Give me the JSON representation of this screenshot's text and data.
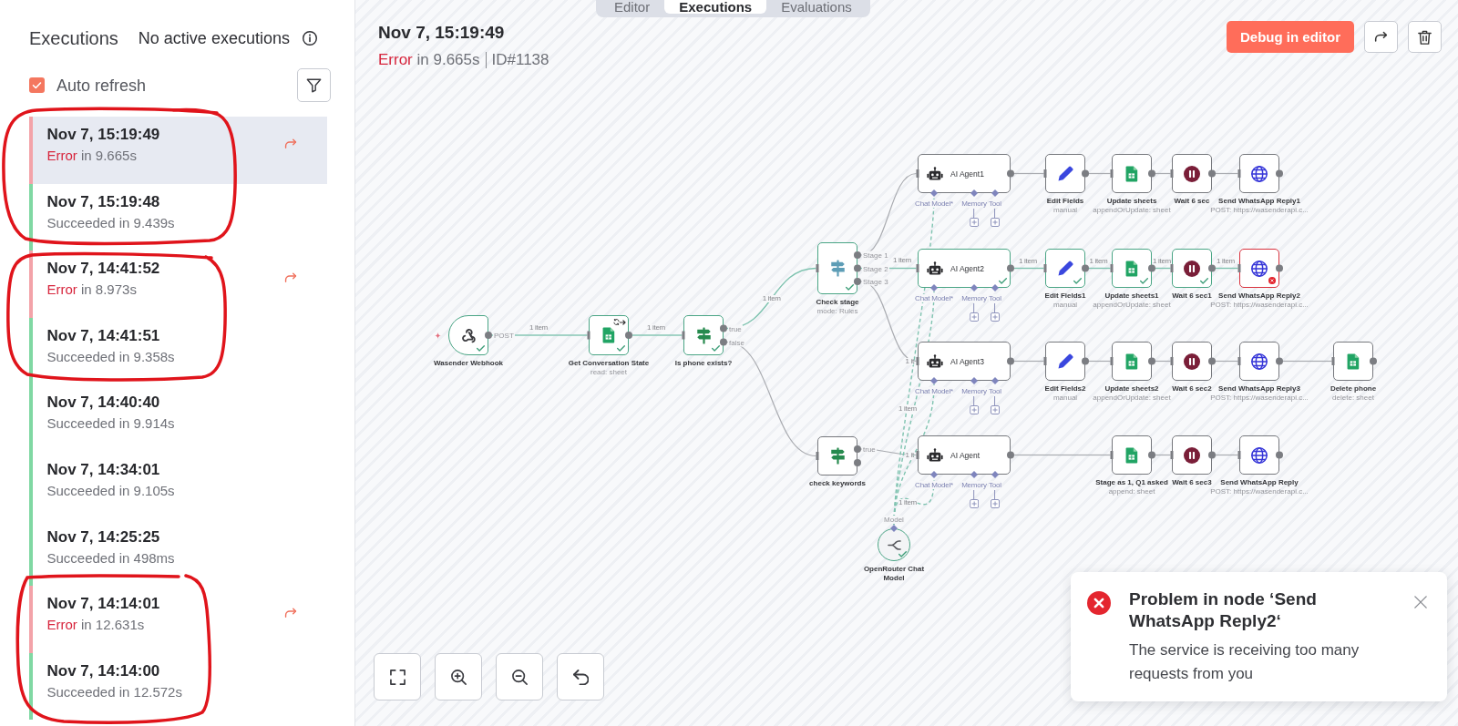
{
  "view_tabs": [
    {
      "label": "Editor",
      "selected": false
    },
    {
      "label": "Executions",
      "selected": true
    },
    {
      "label": "Evaluations",
      "selected": false
    }
  ],
  "sidebar": {
    "title": "Executions",
    "active_status": "No active executions",
    "auto_refresh": {
      "label": "Auto refresh",
      "checked": true
    },
    "executions": [
      {
        "time": "Nov 7, 15:19:49",
        "failed": true,
        "status_label": "Error",
        "duration": "in 9.665s",
        "selected": true
      },
      {
        "time": "Nov 7, 15:19:48",
        "failed": false,
        "status_label": "Succeeded",
        "duration": "in 9.439s",
        "selected": false
      },
      {
        "time": "Nov 7, 14:41:52",
        "failed": true,
        "status_label": "Error",
        "duration": "in 8.973s",
        "selected": false
      },
      {
        "time": "Nov 7, 14:41:51",
        "failed": false,
        "status_label": "Succeeded",
        "duration": "in 9.358s",
        "selected": false
      },
      {
        "time": "Nov 7, 14:40:40",
        "failed": false,
        "status_label": "Succeeded",
        "duration": "in 9.914s",
        "selected": false
      },
      {
        "time": "Nov 7, 14:34:01",
        "failed": false,
        "status_label": "Succeeded",
        "duration": "in 9.105s",
        "selected": false
      },
      {
        "time": "Nov 7, 14:25:25",
        "failed": false,
        "status_label": "Succeeded",
        "duration": "in 498ms",
        "selected": false
      },
      {
        "time": "Nov 7, 14:14:01",
        "failed": true,
        "status_label": "Error",
        "duration": "in 12.631s",
        "selected": false
      },
      {
        "time": "Nov 7, 14:14:00",
        "failed": false,
        "status_label": "Succeeded",
        "duration": "in 12.572s",
        "selected": false
      }
    ]
  },
  "execution_header": {
    "title": "Nov 7, 15:19:49",
    "failed": true,
    "status_label": "Error",
    "duration": "in 9.665s",
    "id": "ID#1138",
    "debug_button": "Debug in editor"
  },
  "workflow": {
    "nodes": [
      {
        "name": "Wasender Webhook",
        "kind": "webhook",
        "executed": true,
        "failed": false,
        "outputs": [
          "POST"
        ]
      },
      {
        "name": "Get Conversation State",
        "subtitle": "read: sheet",
        "kind": "sheets",
        "executed": true,
        "failed": false,
        "retry_on_fail": true,
        "always_output_data": true
      },
      {
        "name": "Is phone exists?",
        "kind": "if",
        "executed": true,
        "failed": false,
        "outputs": [
          "true",
          "false"
        ]
      },
      {
        "name": "Check stage",
        "subtitle": "mode: Rules",
        "kind": "switch",
        "executed": true,
        "failed": false,
        "outputs": [
          "Stage 1",
          "Stage 2",
          "Stage 3"
        ]
      },
      {
        "name": "check keywords",
        "kind": "if",
        "executed": false,
        "failed": false,
        "outputs": [
          "true"
        ]
      },
      {
        "name": "OpenRouter Chat Model",
        "kind": "chat_model",
        "executed": true,
        "failed": false,
        "outputs": [
          "Model"
        ]
      },
      {
        "name": "AI Agent1",
        "kind": "agent",
        "executed": false,
        "failed": false,
        "slots": [
          {
            "label": "Chat Model*",
            "add_button": false
          },
          {
            "label": "Memory",
            "add_button": true
          },
          {
            "label": "Tool",
            "add_button": true
          }
        ]
      },
      {
        "name": "Edit Fields",
        "subtitle": "manual",
        "kind": "set",
        "executed": false,
        "failed": false
      },
      {
        "name": "Update sheets",
        "subtitle": "appendOrUpdate: sheet",
        "kind": "sheets",
        "executed": false,
        "failed": false
      },
      {
        "name": "Wait 6 sec",
        "kind": "wait",
        "executed": false,
        "failed": false
      },
      {
        "name": "Send WhatsApp Reply1",
        "subtitle": "POST: https://wasenderapi.c...",
        "kind": "http",
        "executed": false,
        "failed": false
      },
      {
        "name": "AI Agent2",
        "kind": "agent",
        "executed": true,
        "failed": false,
        "slots": [
          {
            "label": "Chat Model*",
            "add_button": false
          },
          {
            "label": "Memory",
            "add_button": true
          },
          {
            "label": "Tool",
            "add_button": true
          }
        ]
      },
      {
        "name": "Edit Fields1",
        "subtitle": "manual",
        "kind": "set",
        "executed": true,
        "failed": false
      },
      {
        "name": "Update sheets1",
        "subtitle": "appendOrUpdate: sheet",
        "kind": "sheets",
        "executed": true,
        "failed": false
      },
      {
        "name": "Wait 6 sec1",
        "kind": "wait",
        "executed": true,
        "failed": false
      },
      {
        "name": "Send WhatsApp Reply2",
        "subtitle": "POST: https://wasenderapi.c...",
        "kind": "http",
        "executed": true,
        "failed": true
      },
      {
        "name": "AI Agent3",
        "kind": "agent",
        "executed": false,
        "failed": false,
        "slots": [
          {
            "label": "Chat Model*",
            "add_button": false
          },
          {
            "label": "Memory",
            "add_button": true
          },
          {
            "label": "Tool",
            "add_button": true
          }
        ]
      },
      {
        "name": "Edit Fields2",
        "subtitle": "manual",
        "kind": "set",
        "executed": false,
        "failed": false
      },
      {
        "name": "Update sheets2",
        "subtitle": "appendOrUpdate: sheet",
        "kind": "sheets",
        "executed": false,
        "failed": false
      },
      {
        "name": "Wait 6 sec2",
        "kind": "wait",
        "executed": false,
        "failed": false
      },
      {
        "name": "Send WhatsApp Reply3",
        "subtitle": "POST: https://wasenderapi.c...",
        "kind": "http",
        "executed": false,
        "failed": false
      },
      {
        "name": "Delete phone",
        "subtitle": "delete: sheet",
        "kind": "sheets",
        "executed": false,
        "failed": false
      },
      {
        "name": "AI Agent",
        "kind": "agent",
        "executed": false,
        "failed": false,
        "slots": [
          {
            "label": "Chat Model*",
            "add_button": false
          },
          {
            "label": "Memory",
            "add_button": true
          },
          {
            "label": "Tool",
            "add_button": true
          }
        ]
      },
      {
        "name": "Stage as 1, Q1 asked",
        "subtitle": "append: sheet",
        "kind": "sheets",
        "executed": false,
        "failed": false
      },
      {
        "name": "Wait 6 sec3",
        "kind": "wait",
        "executed": false,
        "failed": false
      },
      {
        "name": "Send WhatsApp Reply",
        "subtitle": "POST: https://wasenderapi.c...",
        "kind": "http",
        "executed": false,
        "failed": false
      }
    ],
    "connections": [
      {
        "kind": "main",
        "executed": true,
        "label": "1 item"
      },
      {
        "kind": "main",
        "executed": true,
        "label": "1 item"
      },
      {
        "kind": "main",
        "executed": true,
        "label": "1 item"
      },
      {
        "kind": "main",
        "executed": false
      },
      {
        "kind": "main",
        "executed": false
      },
      {
        "kind": "main",
        "executed": true,
        "label": "1 item"
      },
      {
        "kind": "main",
        "executed": false
      },
      {
        "kind": "main",
        "executed": false
      },
      {
        "kind": "main",
        "executed": false
      },
      {
        "kind": "main",
        "executed": false
      },
      {
        "kind": "main",
        "executed": false
      },
      {
        "kind": "main",
        "executed": false
      },
      {
        "kind": "main",
        "executed": true,
        "label": "1 item"
      },
      {
        "kind": "main",
        "executed": true,
        "label": "1 item"
      },
      {
        "kind": "main",
        "executed": true,
        "label": "1 item"
      },
      {
        "kind": "main",
        "executed": true,
        "label": "1 item"
      },
      {
        "kind": "main",
        "executed": false
      },
      {
        "kind": "main",
        "executed": false
      },
      {
        "kind": "main",
        "executed": false
      },
      {
        "kind": "main",
        "executed": false
      },
      {
        "kind": "main",
        "executed": false
      },
      {
        "kind": "main",
        "executed": false
      },
      {
        "kind": "main",
        "executed": false
      },
      {
        "kind": "main",
        "executed": false
      },
      {
        "kind": "ai",
        "executed": true,
        "label": "1 it"
      },
      {
        "kind": "ai",
        "executed": true,
        "label": "1 item"
      },
      {
        "kind": "ai",
        "executed": true,
        "label": "1 it"
      },
      {
        "kind": "ai",
        "executed": true,
        "label": "1 item"
      }
    ]
  },
  "toast": {
    "kind": "error",
    "title": "Problem in node ‘Send WhatsApp Reply2‘",
    "message": "The service is receiving too many requests from you"
  }
}
